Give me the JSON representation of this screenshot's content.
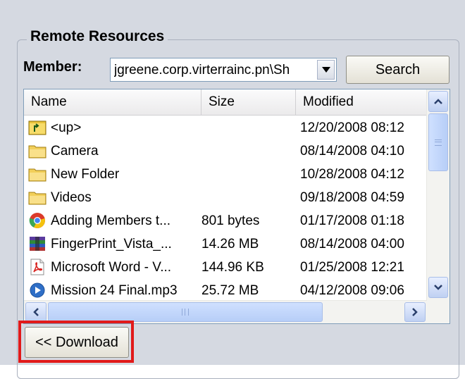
{
  "group": {
    "title": "Remote Resources"
  },
  "member": {
    "label": "Member:",
    "value": "jgreene.corp.virterrainc.pn\\Sh"
  },
  "search_button": "Search",
  "file_list": {
    "columns": [
      "Name",
      "Size",
      "Modified"
    ],
    "rows": [
      {
        "icon": "folder-up-icon",
        "name": "<up>",
        "size": "",
        "modified": "12/20/2008 08:12"
      },
      {
        "icon": "folder-icon",
        "name": "Camera",
        "size": "",
        "modified": "08/14/2008 04:10"
      },
      {
        "icon": "folder-icon",
        "name": "New Folder",
        "size": "",
        "modified": "10/28/2008 04:12"
      },
      {
        "icon": "folder-icon",
        "name": "Videos",
        "size": "",
        "modified": "09/18/2008 04:59"
      },
      {
        "icon": "chrome-file-icon",
        "name": "Adding Members t...",
        "size": "801 bytes",
        "modified": "01/17/2008 01:18"
      },
      {
        "icon": "archive-file-icon",
        "name": "FingerPrint_Vista_...",
        "size": "14.26 MB",
        "modified": "08/14/2008 04:00"
      },
      {
        "icon": "pdf-file-icon",
        "name": "Microsoft Word - V...",
        "size": "144.96 KB",
        "modified": "01/25/2008 12:21"
      },
      {
        "icon": "media-file-icon",
        "name": "Mission 24 Final.mp3",
        "size": "25.72 MB",
        "modified": "04/12/2008 09:06"
      }
    ]
  },
  "download_button": "<< Download",
  "colors": {
    "highlight": "#e11a1a",
    "panel": "#d5d9e1"
  }
}
